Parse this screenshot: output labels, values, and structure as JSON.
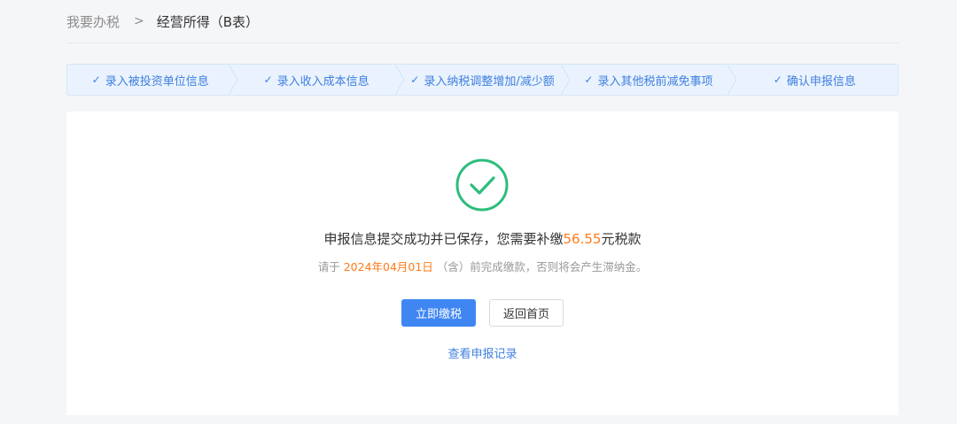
{
  "breadcrumb": {
    "parent": "我要办税",
    "separator": ">",
    "current": "经营所得（B表）"
  },
  "steps": [
    {
      "label": "录入被投资单位信息",
      "icon": "check-icon"
    },
    {
      "label": "录入收入成本信息",
      "icon": "check-icon"
    },
    {
      "label": "录入纳税调整增加/减少额",
      "icon": "check-icon"
    },
    {
      "label": "录入其他税前减免事项",
      "icon": "check-icon"
    },
    {
      "label": "确认申报信息",
      "icon": "check-icon"
    }
  ],
  "result": {
    "icon": "success-check-circle-icon",
    "title_prefix": "申报信息提交成功并已保存，您需要补缴",
    "amount": "56.55",
    "title_suffix": "元税款",
    "sub_prefix": "请于 ",
    "deadline": "2024年04月01日",
    "sub_suffix": " （含）前完成缴款，否则将会产生滞纳金。"
  },
  "actions": {
    "pay_now": "立即缴税",
    "back_home": "返回首页",
    "view_records": "查看申报记录"
  },
  "colors": {
    "primary": "#3f86f3",
    "accent_orange": "#ff7a1a",
    "success_green": "#2dbd7c",
    "step_bg": "#eaf3fd"
  }
}
